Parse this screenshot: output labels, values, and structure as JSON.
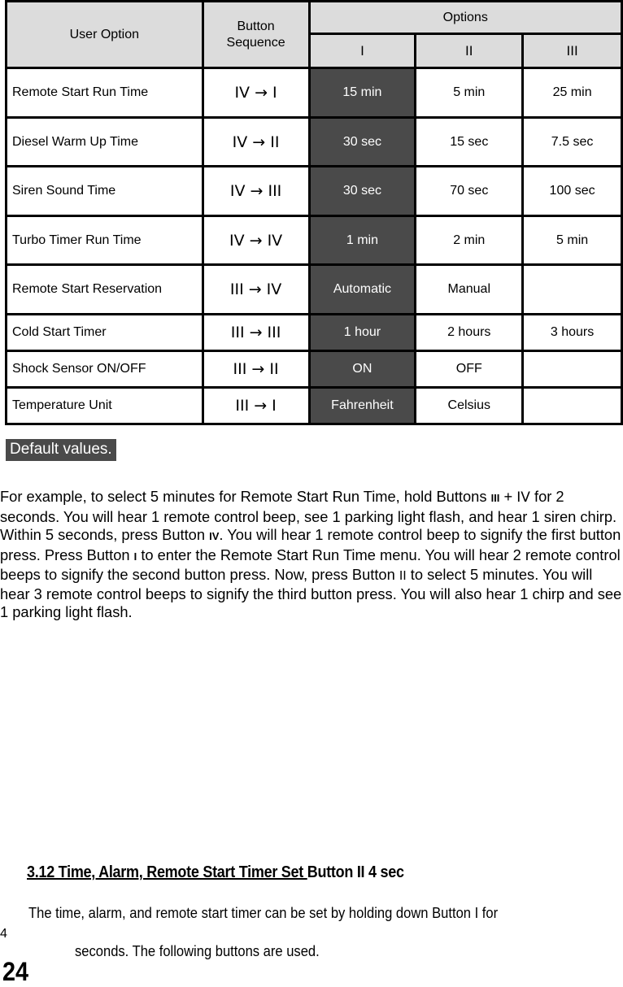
{
  "table": {
    "headers": {
      "user_option": "User Option",
      "button_sequence": "Button\nSequence",
      "options": "Options",
      "option_cols": [
        "I",
        "II",
        "III"
      ]
    },
    "rows": [
      {
        "option": "Remote Start Run Time",
        "sequence": "IV →  I",
        "values": [
          "15 min",
          "5 min",
          "25 min"
        ]
      },
      {
        "option": "Diesel Warm Up Time",
        "sequence": "IV →  II",
        "values": [
          "30 sec",
          "15 sec",
          "7.5 sec"
        ]
      },
      {
        "option": "Siren Sound Time",
        "sequence": "IV → III",
        "values": [
          "30 sec",
          "70 sec",
          "100 sec"
        ]
      },
      {
        "option": "Turbo Timer Run Time",
        "sequence": "IV → IV",
        "values": [
          "1 min",
          "2 min",
          "5 min"
        ]
      },
      {
        "option": "Remote Start Reservation",
        "sequence": "III → IV",
        "values": [
          "Automatic",
          "Manual",
          ""
        ]
      },
      {
        "option": "Cold Start Timer",
        "sequence": "III → III",
        "values": [
          "1 hour",
          "2 hours",
          "3 hours"
        ]
      },
      {
        "option": "Shock Sensor ON/OFF",
        "sequence": "III →  II",
        "values": [
          "ON",
          "OFF",
          ""
        ]
      },
      {
        "option": "Temperature Unit",
        "sequence": "III → I",
        "values": [
          "Fahrenheit",
          "Celsius",
          ""
        ]
      }
    ],
    "default_color": "#4a4a4a",
    "header_color": "#dcdcdc"
  },
  "legend": {
    "default_label": "Default values."
  },
  "example": {
    "p1": "For example, to select 5 minutes for Remote Start Run Time, hold Buttons ",
    "b1": "III",
    "p2": " + ",
    "b2": "IV",
    "p3": " for 2 seconds.  You will hear 1 remote control beep, see 1 parking light flash, and hear 1 siren chirp.  Within 5 seconds, press Button ",
    "b3": "IV",
    "p4": ".  You will hear 1 remote control beep to signify the first button press.  Press Button ",
    "b4": "I",
    "p5": " to enter the Remote Start Run Time menu.  You will hear 2 remote control beeps to signify the second button press.  Now, press  Button ",
    "b5": "II",
    "p6": "  to select 5 minutes.  You will hear 3 remote control beeps to signify the third button press. You will also hear 1 chirp and see 1 parking light flash."
  },
  "section": {
    "title_underlined": "3.12   Time, Alarm, Remote Start Timer Set ",
    "title_rest": " Button II 4 sec",
    "line1": "The time, alarm, and remote start timer can be set by holding down Button I for",
    "line1_wrap": "4",
    "line2": "seconds.  The following buttons are used."
  },
  "page_number": "24"
}
